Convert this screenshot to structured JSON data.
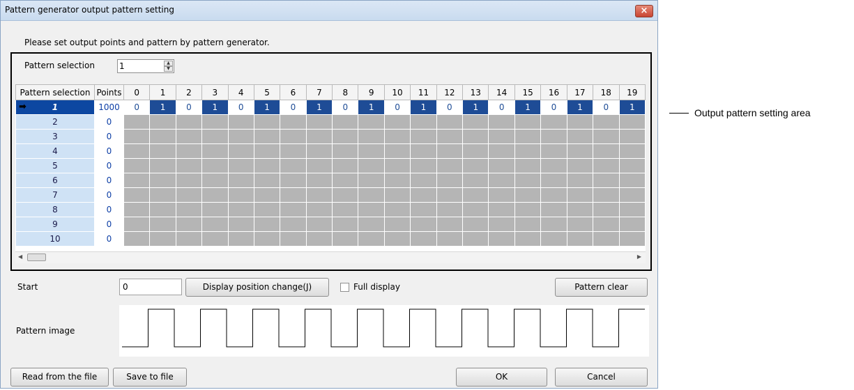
{
  "window": {
    "title": "Pattern generator output pattern setting",
    "close_label": "×"
  },
  "instruction": "Please set output points and pattern by pattern generator.",
  "pattern_selection": {
    "label": "Pattern selection",
    "value": "1"
  },
  "grid": {
    "header_pattern": "Pattern selection",
    "header_points": "Points",
    "columns": [
      "0",
      "1",
      "2",
      "3",
      "4",
      "5",
      "6",
      "7",
      "8",
      "9",
      "10",
      "11",
      "12",
      "13",
      "14",
      "15",
      "16",
      "17",
      "18",
      "19"
    ],
    "rows": [
      {
        "label": "1",
        "points": "1000",
        "active": true,
        "bits": [
          "0",
          "1",
          "0",
          "1",
          "0",
          "1",
          "0",
          "1",
          "0",
          "1",
          "0",
          "1",
          "0",
          "1",
          "0",
          "1",
          "0",
          "1",
          "0",
          "1"
        ]
      },
      {
        "label": "2",
        "points": "0"
      },
      {
        "label": "3",
        "points": "0"
      },
      {
        "label": "4",
        "points": "0"
      },
      {
        "label": "5",
        "points": "0"
      },
      {
        "label": "6",
        "points": "0"
      },
      {
        "label": "7",
        "points": "0"
      },
      {
        "label": "8",
        "points": "0"
      },
      {
        "label": "9",
        "points": "0"
      },
      {
        "label": "10",
        "points": "0"
      }
    ],
    "active_row_icon": "arrow-right-icon"
  },
  "start": {
    "label": "Start",
    "value": "0"
  },
  "buttons": {
    "display_position": "Display position change(J)",
    "pattern_clear": "Pattern clear",
    "read_file": "Read from the file",
    "save_file": "Save to file",
    "ok": "OK",
    "cancel": "Cancel"
  },
  "full_display": {
    "label": "Full display",
    "checked": false
  },
  "pattern_image": {
    "label": "Pattern image",
    "levels": [
      0,
      1,
      0,
      1,
      0,
      1,
      0,
      1,
      0,
      1,
      0,
      1,
      0,
      1,
      0,
      1,
      0,
      1,
      0,
      1
    ]
  },
  "annotation": {
    "text": "Output pattern setting area"
  },
  "colors": {
    "accent": "#1e4c96",
    "row_header": "#cfe2f5",
    "empty_cell": "#b5b5b5"
  }
}
